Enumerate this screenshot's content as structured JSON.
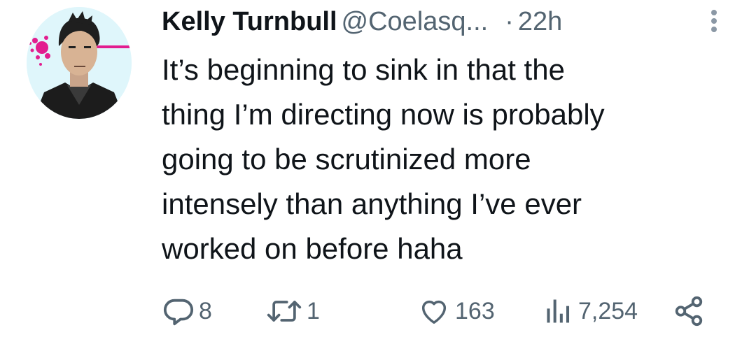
{
  "tweet": {
    "author_name": "Kelly Turnbull",
    "handle": "@Coelasq...",
    "separator": "·",
    "time": "22h",
    "text": "It’s beginning to sink in that the\nthing I’m directing now is probably\ngoing to be scrutinized more\nintensely than anything I’ve ever\nworked on before haha"
  },
  "actions": {
    "replies": "8",
    "reposts": "1",
    "likes": "163",
    "views": "7,254"
  },
  "icons": {
    "reply": "reply-icon",
    "repost": "repost-icon",
    "like": "heart-icon",
    "views": "views-icon",
    "share": "share-icon",
    "more": "more-vertical-icon"
  },
  "colors": {
    "text": "#0f1419",
    "secondary": "#536471",
    "avatar_accent": "#e21d8f"
  }
}
